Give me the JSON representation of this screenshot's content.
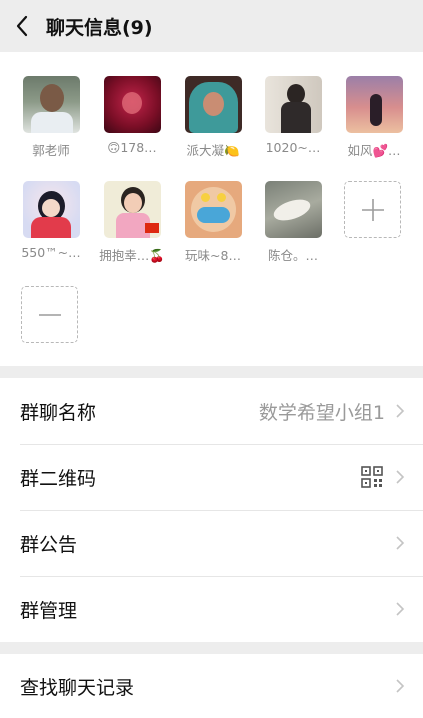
{
  "header": {
    "title": "聊天信息(9)",
    "back_icon": "chevron-left-icon"
  },
  "members": [
    {
      "name": "郭老师"
    },
    {
      "name": "🙃178…"
    },
    {
      "name": "派大凝🍋"
    },
    {
      "name": "1020~…"
    },
    {
      "name": "如风💕…"
    },
    {
      "name": "550™~…"
    },
    {
      "name": "拥抱幸…🍒"
    },
    {
      "name": "玩味~8…"
    },
    {
      "name": "陈仓。…"
    }
  ],
  "add_member_icon": "plus-icon",
  "remove_member_icon": "minus-icon",
  "settings": [
    {
      "label": "群聊名称",
      "value": "数学希望小组1"
    },
    {
      "label": "群二维码",
      "icon": "qr-code-icon"
    },
    {
      "label": "群公告"
    },
    {
      "label": "群管理"
    }
  ],
  "history": {
    "label": "查找聊天记录"
  },
  "colors": {
    "background": "#ededed",
    "panel": "#ffffff",
    "muted_text": "#8a8a8a"
  }
}
